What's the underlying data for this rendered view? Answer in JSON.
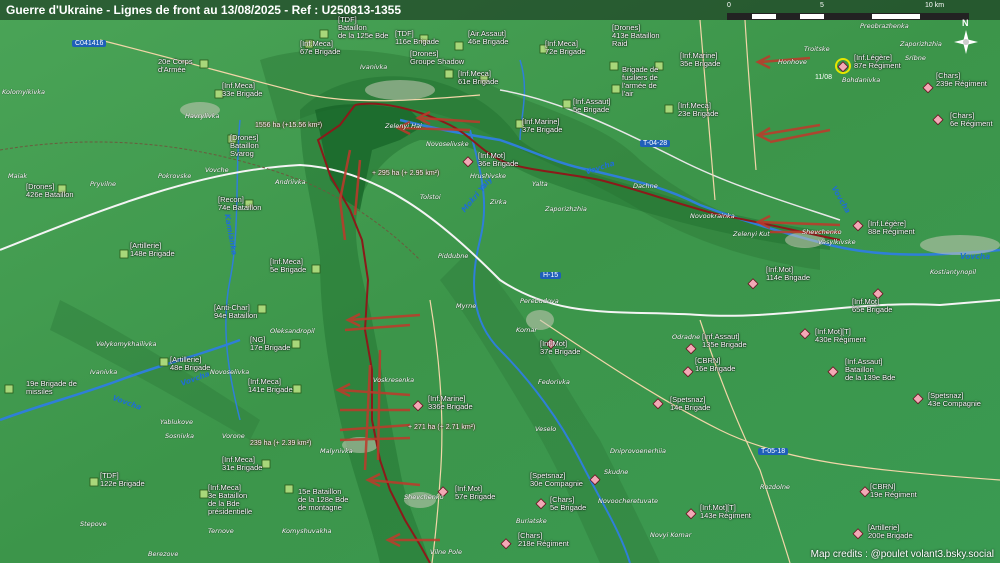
{
  "map": {
    "title": "Guerre d'Ukraine - Lignes de front au 13/08/2025 - Ref : U250813-1355",
    "scale": {
      "labels": [
        "0",
        "5",
        "10 km"
      ]
    },
    "credit": "Map credits : @poulet volant3.bsky.social",
    "compass": "N",
    "date_tag": "11/08",
    "colors": {
      "ukraine_held": "#3f9a4e",
      "russian_gains": "#c0392b",
      "russian_front": "#8b1a1a",
      "river": "#2f7fd8",
      "road": "#ffffff"
    }
  },
  "roads": [
    "C041416",
    "T-04-28",
    "H-15",
    "T-05-18"
  ],
  "rivers": [
    "Vovcha",
    "Vovcha",
    "Vovcha",
    "Vovcha",
    "Mokri Yaly",
    "Vovcha",
    "Kamianka"
  ],
  "gains": [
    "1556 ha (+15.56 km²)",
    "+ 295 ha (+ 2.95 km²)",
    "+ 271 ha (+ 2.71 km²)",
    "239 ha (+ 2.39 km²)"
  ],
  "ua_units": [
    {
      "icon": "infantry-unit-icon",
      "label": "[Inf.Meca]\n67e Brigade"
    },
    {
      "icon": "infantry-unit-icon",
      "label": "[TDF]\nBataillon\nde la 125e Bde"
    },
    {
      "icon": "infantry-unit-icon",
      "label": "[TDF]\n116e Brigade"
    },
    {
      "icon": "airborne-unit-icon",
      "label": "[Air.Assaut]\n46e Brigade"
    },
    {
      "icon": "infantry-unit-icon",
      "label": "[Inf.Meca]\n72e Brigade"
    },
    {
      "icon": "drone-unit-icon",
      "label": "[Drones]\n413e Bataillon\nRaid"
    },
    {
      "icon": "corps-unit-icon",
      "label": "20e Corps\nd'Armée"
    },
    {
      "icon": "drone-unit-icon",
      "label": "[Drones]\nGroupe Shadow"
    },
    {
      "icon": "infantry-unit-icon",
      "label": "[Inf.Meca]\n61e Brigade"
    },
    {
      "icon": "marine-unit-icon",
      "label": "[Inf.Marine]\n35e Brigade"
    },
    {
      "icon": "infantry-unit-icon",
      "label": "Brigade de\nfusiliers de\nl'armée de\nl'air"
    },
    {
      "icon": "infantry-unit-icon",
      "label": "[Inf.Meca]\n33e Brigade"
    },
    {
      "icon": "assault-unit-icon",
      "label": "[Inf.Assaut]\n5e Brigade"
    },
    {
      "icon": "infantry-unit-icon",
      "label": "[Inf.Meca]\n23e Brigade"
    },
    {
      "icon": "marine-unit-icon",
      "label": "[Inf.Marine]\n37e Brigade"
    },
    {
      "icon": "drone-unit-icon",
      "label": "[Drones]\nBataillon\nSvarog"
    },
    {
      "icon": "drone-unit-icon",
      "label": "[Drones]\n426e Bataillon"
    },
    {
      "icon": "recon-unit-icon",
      "label": "[Recon]\n74e Bataillon"
    },
    {
      "icon": "artillery-unit-icon",
      "label": "[Artillerie]\n148e Brigade"
    },
    {
      "icon": "infantry-unit-icon",
      "label": "[Inf.Meca]\n5e Brigade"
    },
    {
      "icon": "anti-air-unit-icon",
      "label": "[Anti-Char]\n94e Bataillon"
    },
    {
      "icon": "national-guard-unit-icon",
      "label": "[NG]\n17e Brigade"
    },
    {
      "icon": "artillery-unit-icon",
      "label": "[Artillerie]\n48e Brigade"
    },
    {
      "icon": "infantry-unit-icon",
      "label": "[Inf.Meca]\n141e Brigade"
    },
    {
      "icon": "missile-unit-icon",
      "label": "19e Brigade de\nmissiles"
    },
    {
      "icon": "infantry-unit-icon",
      "label": "[Inf.Meca]\n31e Brigade"
    },
    {
      "icon": "infantry-unit-icon",
      "label": "[TDF]\n122e Brigade"
    },
    {
      "icon": "infantry-unit-icon",
      "label": "[Inf.Meca]\n3e Bataillon\nde la Bde\nprésidentielle"
    },
    {
      "icon": "mountain-unit-icon",
      "label": "15e Bataillon\nde la 128e Bde\nde montagne"
    }
  ],
  "ru_units": [
    {
      "icon": "infantry-unit-icon",
      "label": "[Inf.Légère]\n87e Régiment"
    },
    {
      "icon": "tank-unit-icon",
      "label": "[Chars]\n239e Régiment"
    },
    {
      "icon": "tank-unit-icon",
      "label": "[Chars]\n6e Régiment"
    },
    {
      "icon": "infantry-unit-icon",
      "label": "[Inf.Mot]\n36e Brigade"
    },
    {
      "icon": "infantry-unit-icon",
      "label": "[Inf.Légère]\n88e Régiment"
    },
    {
      "icon": "infantry-unit-icon",
      "label": "[Inf.Mot]\n114e Brigade"
    },
    {
      "icon": "infantry-unit-icon",
      "label": "[Inf.Mot]\n65e Brigade"
    },
    {
      "icon": "infantry-unit-icon",
      "label": "[Inf.Mot][T]\n430e Régiment"
    },
    {
      "icon": "infantry-unit-icon",
      "label": "[Inf.Mot]\n37e Brigade"
    },
    {
      "icon": "assault-unit-icon",
      "label": "[Inf.Assaut]\n135e Brigade"
    },
    {
      "icon": "chemical-unit-icon",
      "label": "[CBRN]\n16e Brigade"
    },
    {
      "icon": "assault-unit-icon",
      "label": "[Inf.Assaut]\nBataillon\nde la 139e Bde"
    },
    {
      "icon": "marine-unit-icon",
      "label": "[Inf.Marine]\n336e Brigade"
    },
    {
      "icon": "special-forces-unit-icon",
      "label": "[Spetsnaz]\n14e Brigade"
    },
    {
      "icon": "special-forces-unit-icon",
      "label": "[Spetsnaz]\n43e Compagnie"
    },
    {
      "icon": "infantry-unit-icon",
      "label": "[Inf.Mot]\n57e Brigade"
    },
    {
      "icon": "special-forces-unit-icon",
      "label": "[Spetsnaz]\n30e Compagnie"
    },
    {
      "icon": "tank-unit-icon",
      "label": "[Chars]\n5e Brigade"
    },
    {
      "icon": "infantry-unit-icon",
      "label": "[Inf.Mot][T]\n143e Régiment"
    },
    {
      "icon": "chemical-unit-icon",
      "label": "[CBRN]\n19e Régiment"
    },
    {
      "icon": "tank-unit-icon",
      "label": "[Chars]\n218e Régiment"
    },
    {
      "icon": "artillery-unit-icon",
      "label": "[Artillerie]\n200e Brigade"
    }
  ],
  "towns": [
    "Ivanivka",
    "Preobrazhenka",
    "Zaporizhzhia",
    "Troitske",
    "Honhove",
    "Bohdanivka",
    "Sribne",
    "Kolomyikivka",
    "Havrylivka",
    "Pokrovske",
    "Zelenyi Hai",
    "Novoselivske",
    "Vovche",
    "Maiak",
    "Pryvilne",
    "Andriivka",
    "Hrushivske",
    "Dachne",
    "Novookrainka",
    "Zelenyi Kut",
    "Tolstoi",
    "Zirka",
    "Zaporizhzhia",
    "Shevchenko",
    "Vasylkivske",
    "Piddubne",
    "Kostiantynopil",
    "Myrne",
    "Perebudova",
    "Komar",
    "Oleksandropil",
    "Velykomykhailivka",
    "Ivanivka",
    "Novoselivka",
    "Yablukove",
    "Sosnivka",
    "Voskresenka",
    "Vorone",
    "Malynivka",
    "Fedorivka",
    "Veselo",
    "Dniprovoenerhiia",
    "Skudne",
    "Rozdolne",
    "Shevchenko",
    "Novoocheretuvate",
    "Buriatske",
    "Novyi Komar",
    "Vilne Pole",
    "Stepove",
    "Ternove",
    "Komyshuvakha",
    "Berezove",
    "Yalta",
    "Odradne"
  ]
}
